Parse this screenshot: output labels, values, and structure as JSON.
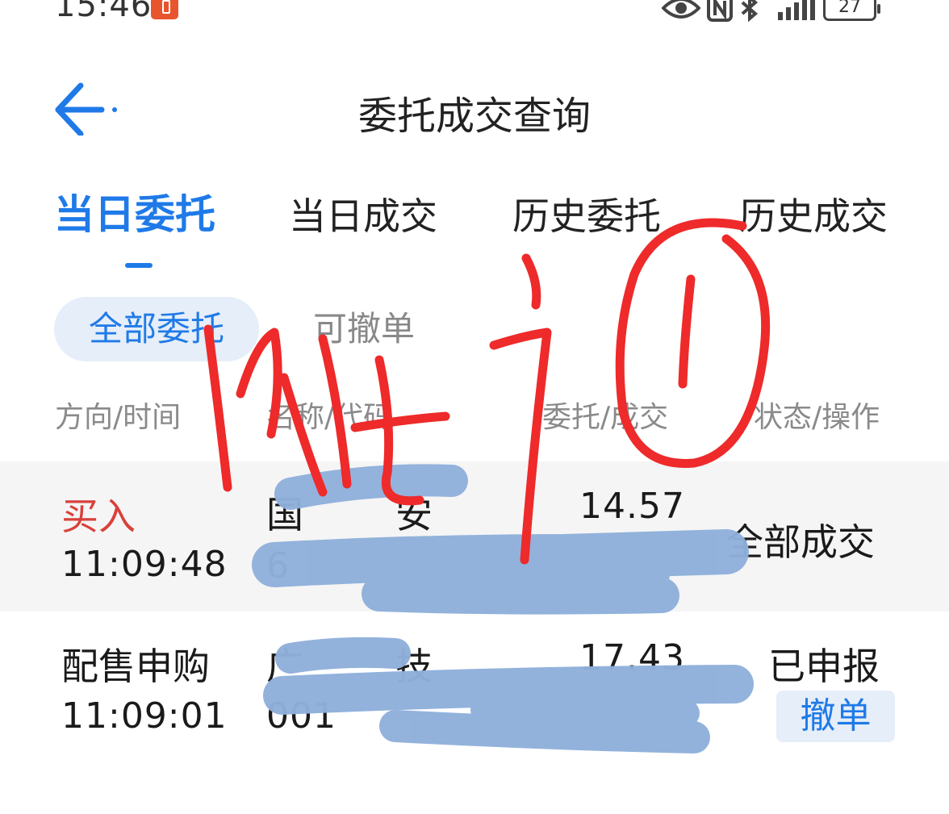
{
  "status_bar": {
    "time": "15:46",
    "battery": "27",
    "icons": [
      "alert-badge-icon",
      "eye-icon",
      "nfc-icon",
      "bluetooth-icon",
      "5g-signal-icon",
      "battery-icon"
    ]
  },
  "header": {
    "title": "委托成交查询",
    "back_icon": "arrow-left-icon"
  },
  "tabs": [
    {
      "label": "当日委托",
      "active": true
    },
    {
      "label": "当日成交",
      "active": false
    },
    {
      "label": "历史委托",
      "active": false
    },
    {
      "label": "历史成交",
      "active": false
    }
  ],
  "filters": [
    {
      "label": "全部委托",
      "active": true
    },
    {
      "label": "可撤单",
      "active": false
    }
  ],
  "columns": [
    "方向/时间",
    "名称/代码",
    "委托/成交",
    "状态/操作"
  ],
  "orders": [
    {
      "direction": "买入",
      "time": "11:09:48",
      "name": "国",
      "name_tail": "安",
      "code": "6",
      "price": "14.57",
      "status": "全部成交"
    },
    {
      "direction": "配售申购",
      "time": "11:09:01",
      "name": "广",
      "name_tail": "技",
      "code": "001",
      "price": "17.43",
      "status": "已申报",
      "action": "撤单"
    }
  ],
  "colors": {
    "accent": "#1f7ae8",
    "buy": "#d94039",
    "row_highlight": "#f5f5f5",
    "handwriting": "#ee2a2a",
    "redaction": "#8fb0db"
  }
}
